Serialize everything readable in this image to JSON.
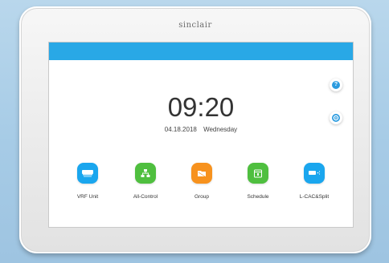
{
  "brand": "sinclair",
  "clock": {
    "time": "09:20",
    "date": "04.18.2018",
    "weekday": "Wednesday"
  },
  "side_buttons": [
    {
      "name": "help",
      "icon": "help-icon",
      "glyph": "?"
    },
    {
      "name": "settings",
      "icon": "settings-icon"
    }
  ],
  "apps": [
    {
      "label": "VRF Unit",
      "color": "#1aa6ee",
      "icon": "vrf-unit-icon"
    },
    {
      "label": "All-Control",
      "color": "#4fbf3f",
      "icon": "all-control-icon"
    },
    {
      "label": "Group",
      "color": "#f7921e",
      "icon": "group-icon"
    },
    {
      "label": "Schedule",
      "color": "#4fbf3f",
      "icon": "schedule-icon"
    },
    {
      "label": "L-CAC&Split",
      "color": "#1aa6ee",
      "icon": "split-icon"
    }
  ],
  "colors": {
    "top_bar": "#29a8e6",
    "background": "#a9cde7"
  }
}
